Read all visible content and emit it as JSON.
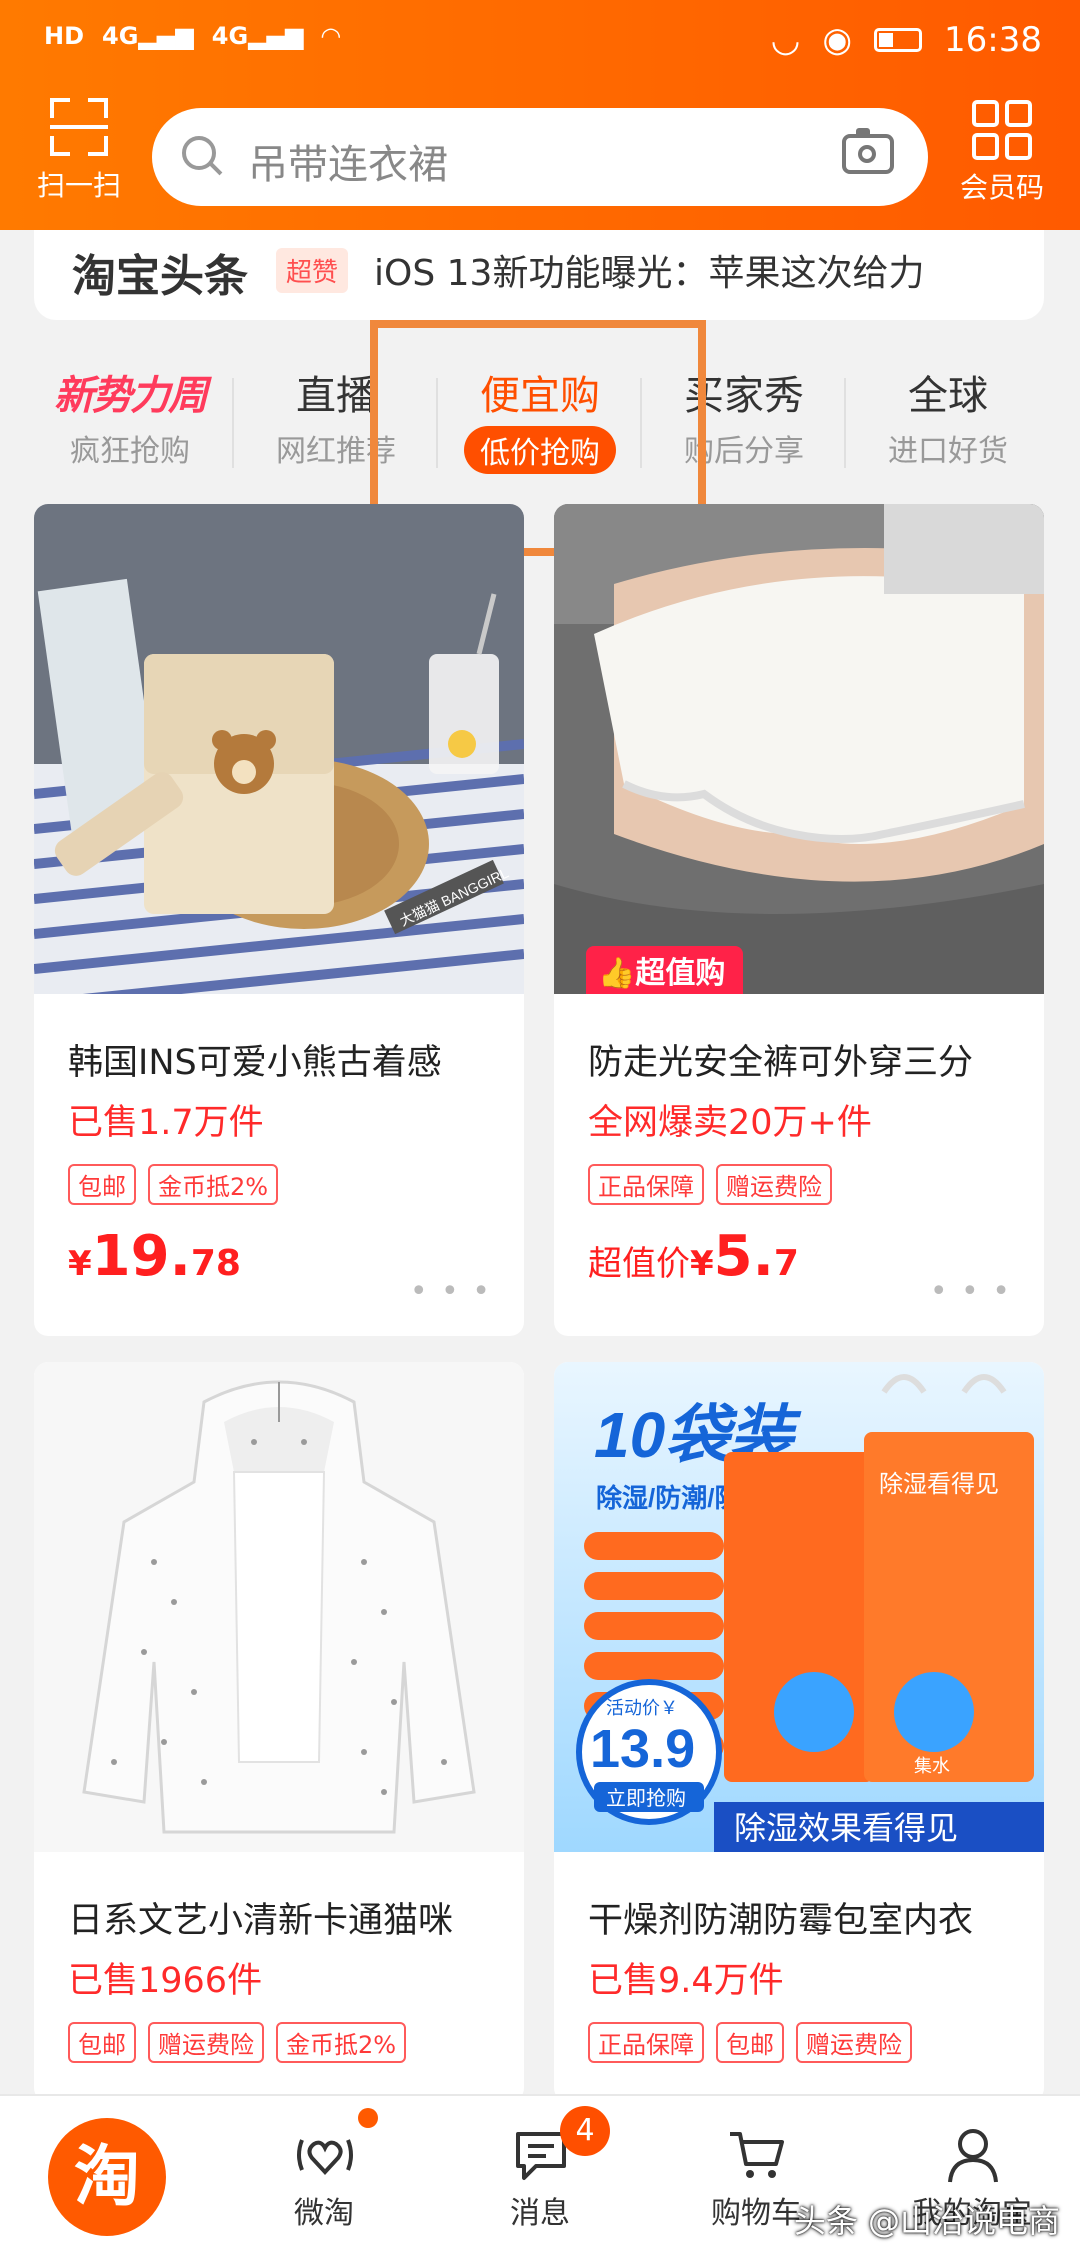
{
  "status_bar": {
    "hd": "HD",
    "net1": "4G",
    "net2": "4G",
    "time": "16:38"
  },
  "header": {
    "scan_label": "扫一扫",
    "search_placeholder": "吊带连衣裙",
    "member_label": "会员码"
  },
  "headline": {
    "title": "淘宝头条",
    "badge": "超赞",
    "text": "iOS 13新功能曝光：苹果这次给力"
  },
  "channels": [
    {
      "title": "新势力周",
      "sub": "疯狂抢购"
    },
    {
      "title": "直播",
      "sub": "网红推荐"
    },
    {
      "title": "便宜购",
      "sub": "低价抢购"
    },
    {
      "title": "买家秀",
      "sub": "购后分享"
    },
    {
      "title": "全球",
      "sub": "进口好货"
    }
  ],
  "products": [
    {
      "title": "韩国INS可爱小熊古着感",
      "sold": "已售1.7万件",
      "tags": [
        "包邮",
        "金币抵2%"
      ],
      "price_symbol": "¥",
      "price_int": "19.",
      "price_dec": "78",
      "image_label": "大猫猫 BANGGIRL"
    },
    {
      "title": "防走光安全裤可外穿三分",
      "sold": "全网爆卖20万+件",
      "tags": [
        "正品保障",
        "赠运费险"
      ],
      "price_prefix": "超值价",
      "price_symbol": "¥",
      "price_int": "5.",
      "price_dec": "7",
      "image_badge": "超值购"
    },
    {
      "title": "日系文艺小清新卡通猫咪",
      "sold": "已售1966件",
      "tags": [
        "包邮",
        "赠运费险",
        "金币抵2%"
      ]
    },
    {
      "title": "干燥剂防潮防霉包室内衣",
      "sold": "已售9.4万件",
      "tags": [
        "正品保障",
        "包邮",
        "赠运费险"
      ],
      "image_text": {
        "count": "10袋装",
        "features": "除湿/防潮/防霉",
        "activity": "活动价￥",
        "price": "13.9",
        "buy": "立即抢购",
        "slogan": "除湿效果看得见",
        "pack": "除湿看得见",
        "water": "集水"
      }
    }
  ],
  "tabbar": [
    {
      "label": ""
    },
    {
      "label": "微淘"
    },
    {
      "label": "消息",
      "badge": "4"
    },
    {
      "label": "购物车"
    },
    {
      "label": "我的淘宝"
    }
  ],
  "logo_text": "淘",
  "watermark": "头条 @山治说电商"
}
